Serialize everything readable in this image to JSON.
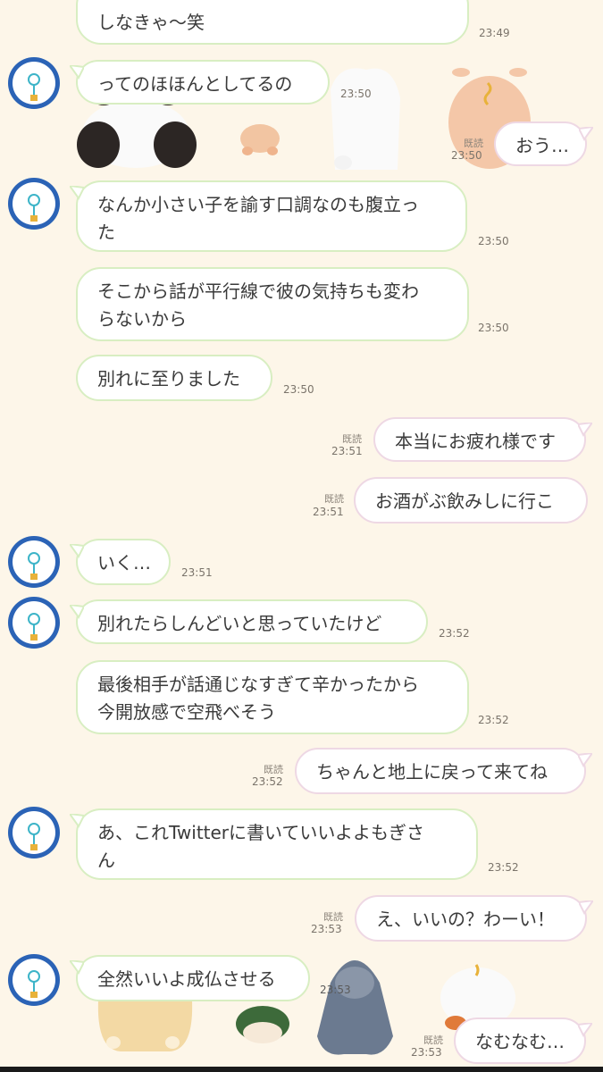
{
  "colors": {
    "background": "#fdf6e9",
    "avatar": "#2b63b6",
    "incoming_border": "#d8eec2",
    "outgoing_border": "#eed8e4"
  },
  "read_label": "既読",
  "messages": [
    {
      "text": "しなきゃ〜笑",
      "time": "23:49"
    },
    {
      "text": "ってのほほんとしてるの",
      "time": "23:50"
    },
    {
      "text": "おう…",
      "time": "23:50"
    },
    {
      "text": "なんか小さい子を諭す口調なのも腹立っ",
      "text2": "た",
      "time": "23:50"
    },
    {
      "text": "そこから話が平行線で彼の気持ちも変わ",
      "text2": "らないから",
      "time": "23:50"
    },
    {
      "text": "別れに至りました",
      "time": "23:50"
    },
    {
      "text": "本当にお疲れ様です",
      "time": "23:51"
    },
    {
      "text": "お酒がぶ飲みしに行こ",
      "time": "23:51"
    },
    {
      "text": "いく…",
      "time": "23:51"
    },
    {
      "text": "別れたらしんどいと思っていたけど",
      "time": "23:52"
    },
    {
      "text": "最後相手が話通じなすぎて辛かったから",
      "text2": "今開放感で空飛べそう",
      "time": "23:52"
    },
    {
      "text": "ちゃんと地上に戻って来てね",
      "time": "23:52"
    },
    {
      "text": "あ、これTwitterに書いていいよよもぎさ",
      "text2": "ん",
      "time": "23:52"
    },
    {
      "text": "え、いいの？わーい！",
      "time": "23:53"
    },
    {
      "text": "全然いいよ成仏させる",
      "time": "23:53"
    },
    {
      "text": "なむなむ…",
      "time": "23:53"
    }
  ]
}
